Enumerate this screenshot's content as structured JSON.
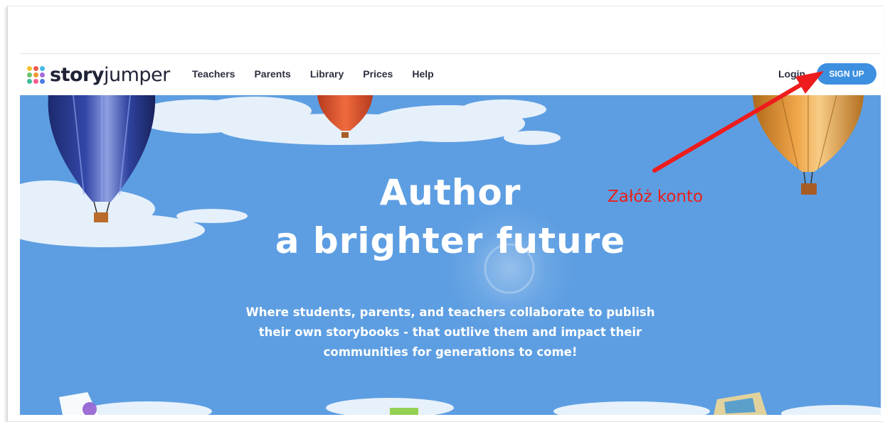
{
  "brand": {
    "name_bold": "story",
    "name_light": "jumper",
    "dot_colors": [
      "#f2c230",
      "#ef5b4b",
      "#47b8e8",
      "#6cc36b",
      "#f29a2e",
      "#a66ad9",
      "#3ebf9a",
      "#f45d8c",
      "#4b7be0"
    ]
  },
  "nav": {
    "links": [
      "Teachers",
      "Parents",
      "Library",
      "Prices",
      "Help"
    ],
    "login_label": "Login",
    "signup_label": "SIGN UP",
    "signup_color": "#3d8fe0"
  },
  "hero": {
    "headline_line1": "Author",
    "headline_line2": "a brighter future",
    "tagline_lines": [
      "Where students, parents, and teachers collaborate to publish",
      "their own storybooks - that outlive them and impact their",
      "communities for generations to come!"
    ],
    "sky_color": "#5d9ee2"
  },
  "annotation": {
    "text": "Załóż konto",
    "color": "#e8201d",
    "arrow_icon": "red-arrow-icon"
  }
}
